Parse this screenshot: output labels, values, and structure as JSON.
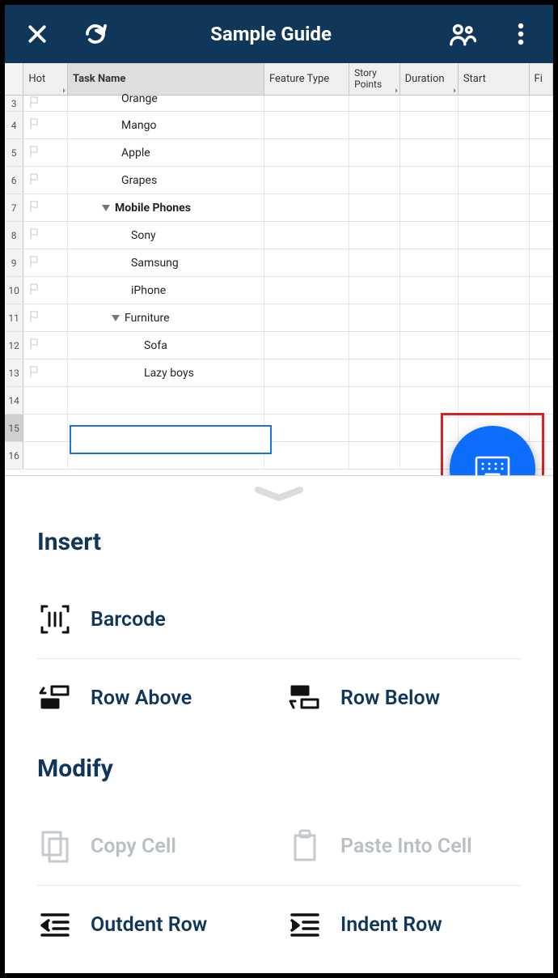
{
  "header": {
    "title": "Sample Guide"
  },
  "columns": {
    "hot": "Hot",
    "task": "Task Name",
    "feature": "Feature Type",
    "story_points": "Story Points",
    "duration": "Duration",
    "start": "Start",
    "finish": "Fi"
  },
  "rows": [
    {
      "num": "3",
      "indent": 1,
      "bold": false,
      "expander": false,
      "label": "Orange"
    },
    {
      "num": "4",
      "indent": 1,
      "bold": false,
      "expander": false,
      "label": "Mango"
    },
    {
      "num": "5",
      "indent": 1,
      "bold": false,
      "expander": false,
      "label": "Apple"
    },
    {
      "num": "6",
      "indent": 1,
      "bold": false,
      "expander": false,
      "label": "Grapes"
    },
    {
      "num": "7",
      "indent": 1,
      "bold": true,
      "expander": true,
      "label": "Mobile Phones"
    },
    {
      "num": "8",
      "indent": 2,
      "bold": false,
      "expander": false,
      "label": "Sony"
    },
    {
      "num": "9",
      "indent": 2,
      "bold": false,
      "expander": false,
      "label": "Samsung"
    },
    {
      "num": "10",
      "indent": 2,
      "bold": false,
      "expander": false,
      "label": "iPhone"
    },
    {
      "num": "11",
      "indent": 2,
      "bold": false,
      "expander": true,
      "label": "Furniture"
    },
    {
      "num": "12",
      "indent": 3,
      "bold": false,
      "expander": false,
      "label": "Sofa"
    },
    {
      "num": "13",
      "indent": 3,
      "bold": false,
      "expander": false,
      "label": "Lazy boys"
    },
    {
      "num": "14",
      "indent": 0,
      "bold": false,
      "expander": false,
      "label": ""
    },
    {
      "num": "15",
      "indent": 0,
      "bold": false,
      "expander": false,
      "label": ""
    },
    {
      "num": "16",
      "indent": 0,
      "bold": false,
      "expander": false,
      "label": ""
    }
  ],
  "panel": {
    "section_insert": "Insert",
    "barcode": "Barcode",
    "row_above": "Row Above",
    "row_below": "Row Below",
    "section_modify": "Modify",
    "copy_cell": "Copy Cell",
    "paste_cell": "Paste Into Cell",
    "outdent_row": "Outdent Row",
    "indent_row": "Indent Row"
  }
}
